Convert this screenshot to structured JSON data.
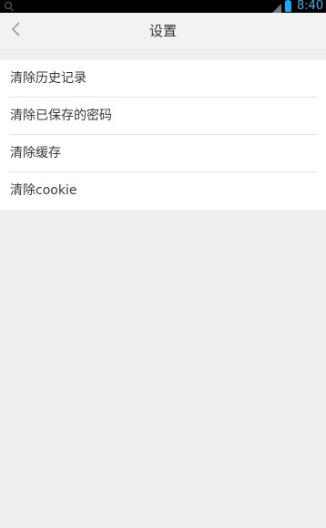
{
  "status_bar": {
    "time": "8:40",
    "search_icon": "search-icon",
    "signal_icon": "signal-icon",
    "battery_icon": "battery-icon",
    "time_color": "#33b5e5"
  },
  "header": {
    "back_icon": "chevron-left-icon",
    "title": "设置"
  },
  "settings": {
    "items": [
      {
        "label": "清除历史记录"
      },
      {
        "label": "清除已保存的密码"
      },
      {
        "label": "清除缓存"
      },
      {
        "label": "清除cookie"
      }
    ]
  }
}
